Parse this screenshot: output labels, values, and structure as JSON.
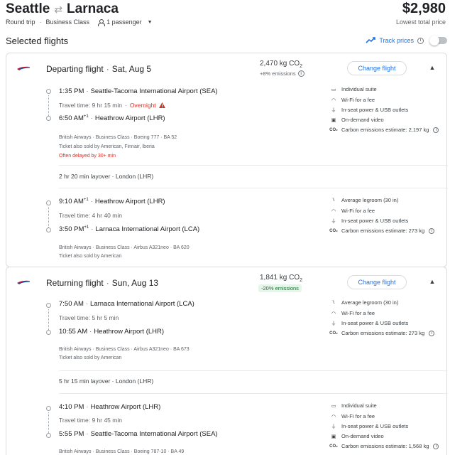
{
  "header": {
    "origin": "Seattle",
    "destination": "Larnaca",
    "trip_type": "Round trip",
    "cabin": "Business Class",
    "passengers": "1 passenger",
    "price": "$2,980",
    "price_note": "Lowest total price"
  },
  "section": {
    "title": "Selected flights",
    "track_prices": "Track prices"
  },
  "departing": {
    "title": "Departing flight",
    "date": "Sat, Aug 5",
    "co2_value": "2,470 kg CO",
    "co2_sub": "2",
    "emissions": "+8% emissions",
    "change_label": "Change flight",
    "seg1": {
      "dep_time": "1:35 PM",
      "dep_airport": "Seattle-Tacoma International Airport (SEA)",
      "travel_time": "Travel time: 9 hr 15 min",
      "overnight": "Overnight",
      "arr_time": "6:50 AM",
      "arr_plus": "+1",
      "arr_airport": "Heathrow Airport (LHR)",
      "airline_line": "British Airways · Business Class · Boeing 777 · BA 52",
      "sold_by": "Ticket also sold by American, Finnair, Iberia",
      "delay": "Often delayed by 30+ min",
      "amenities": [
        "Individual suite",
        "Wi-Fi for a fee",
        "In-seat power & USB outlets",
        "On-demand video",
        "Carbon emissions estimate: 2,197 kg"
      ]
    },
    "layover": "2 hr 20 min layover · London (LHR)",
    "seg2": {
      "dep_time": "9:10 AM",
      "dep_plus": "+1",
      "dep_airport": "Heathrow Airport (LHR)",
      "travel_time": "Travel time: 4 hr 40 min",
      "arr_time": "3:50 PM",
      "arr_plus": "+1",
      "arr_airport": "Larnaca International Airport (LCA)",
      "airline_line": "British Airways · Business Class · Airbus A321neo · BA 620",
      "sold_by": "Ticket also sold by American",
      "amenities": [
        "Average legroom (30 in)",
        "Wi-Fi for a fee",
        "In-seat power & USB outlets",
        "Carbon emissions estimate: 273 kg"
      ]
    }
  },
  "returning": {
    "title": "Returning flight",
    "date": "Sun, Aug 13",
    "co2_value": "1,841 kg CO",
    "co2_sub": "2",
    "emissions": "-20% emissions",
    "change_label": "Change flight",
    "seg1": {
      "dep_time": "7:50 AM",
      "dep_airport": "Larnaca International Airport (LCA)",
      "travel_time": "Travel time: 5 hr 5 min",
      "arr_time": "10:55 AM",
      "arr_airport": "Heathrow Airport (LHR)",
      "airline_line": "British Airways · Business Class · Airbus A321neo · BA 673",
      "sold_by": "Ticket also sold by American",
      "amenities": [
        "Average legroom (30 in)",
        "Wi-Fi for a fee",
        "In-seat power & USB outlets",
        "Carbon emissions estimate: 273 kg"
      ]
    },
    "layover": "5 hr 15 min layover · London (LHR)",
    "seg2": {
      "dep_time": "4:10 PM",
      "dep_airport": "Heathrow Airport (LHR)",
      "travel_time": "Travel time: 9 hr 45 min",
      "arr_time": "5:55 PM",
      "arr_airport": "Seattle-Tacoma International Airport (SEA)",
      "airline_line": "British Airways · Business Class · Boeing 787-10 · BA 49",
      "amenities": [
        "Individual suite",
        "Wi-Fi for a fee",
        "In-seat power & USB outlets",
        "On-demand video",
        "Carbon emissions estimate: 1,568 kg"
      ]
    }
  },
  "colors": {
    "accent": "#1a73e8",
    "warning": "#d93025",
    "green": "#137333"
  }
}
